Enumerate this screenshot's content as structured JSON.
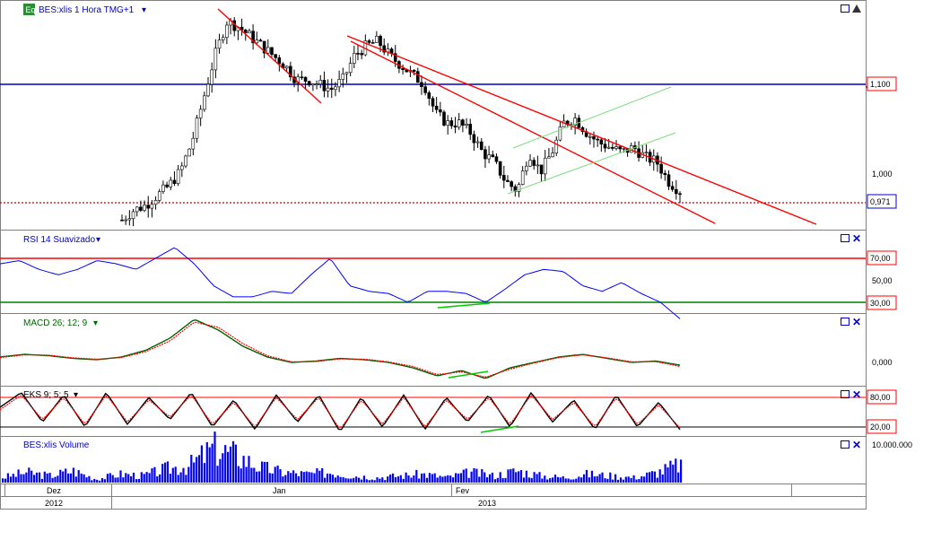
{
  "colors": {
    "frame": "#808080",
    "candle_up": "#000000",
    "candle_down": "#000000",
    "rsi": "#0000ff",
    "macd": "#006400",
    "signal": "#ff0000",
    "stoch_k": "#000000",
    "stoch_d": "#ff0000",
    "volume": "#0000ff",
    "trend": "#ff0000",
    "channel": "#7fdc7f",
    "divergence": "#00cc00",
    "level_blue": "#0000cc",
    "level_red": "#ff0000",
    "level_green": "#008000"
  },
  "header": {
    "badge": "Eq",
    "symbol_title": "BES:xlis 1 Hora TMG+1",
    "caret": "▾"
  },
  "price_panel": {
    "resistance_tag": "1,100",
    "tick_1000": "1,000",
    "last_price_tag": "0,971"
  },
  "rsi_panel": {
    "title": "RSI 14 Suavizado",
    "tags": [
      "70,00",
      "50,00",
      "30,00"
    ]
  },
  "macd_panel": {
    "title": "MACD 26; 12; 9",
    "tick": "0,000"
  },
  "stoch_panel": {
    "title": "EKS 9; 5; 5",
    "tags": [
      "80,00",
      "20,00"
    ]
  },
  "volume_panel": {
    "title": "BES:xlis Volume",
    "tick": "10.000.000"
  },
  "time_axis": {
    "months": [
      "Dez",
      "Jan",
      "Fev"
    ],
    "years": [
      "2012",
      "2013"
    ]
  },
  "chart_data": [
    {
      "type": "candlestick",
      "title": "BES:xlis 1 Hora TMG+1",
      "ylabel": "",
      "xlabel": "",
      "ylim": [
        0.94,
        1.17
      ],
      "x_months": [
        "Dez",
        "Jan",
        "Fev"
      ],
      "y_ticks": [
        1.0,
        1.1
      ],
      "horizontal_levels": [
        1.1,
        0.971
      ],
      "last_price": 0.971,
      "close_approx": [
        0.95,
        0.96,
        0.965,
        0.975,
        0.985,
        1.0,
        1.03,
        1.075,
        1.12,
        1.155,
        1.15,
        1.14,
        1.13,
        1.12,
        1.11,
        1.095,
        1.095,
        1.09,
        1.085,
        1.095,
        1.12,
        1.13,
        1.135,
        1.12,
        1.11,
        1.1,
        1.09,
        1.06,
        1.05,
        1.05,
        1.04,
        1.02,
        1.01,
        0.99,
        0.98,
        1.02,
        1.0,
        1.02,
        1.05,
        1.055,
        1.04,
        1.03,
        1.025,
        1.02,
        1.025,
        1.015,
        1.01,
        0.99,
        0.98
      ],
      "trendlines": 3,
      "channel_lines": 2
    },
    {
      "type": "line",
      "title": "RSI 14 Suavizado",
      "ylim": [
        0,
        100
      ],
      "levels": [
        70,
        50,
        30
      ],
      "series": [
        {
          "values": [
            65,
            68,
            60,
            55,
            60,
            68,
            65,
            60,
            70,
            80,
            65,
            45,
            35,
            35,
            40,
            38,
            55,
            70,
            45,
            40,
            38,
            30,
            40,
            40,
            38,
            30,
            42,
            55,
            60,
            58,
            45,
            40,
            48,
            38,
            30,
            15
          ]
        }
      ]
    },
    {
      "type": "line",
      "title": "MACD 26; 12; 9",
      "y_ticks": [
        0
      ],
      "series": [
        {
          "values": [
            0.2,
            0.3,
            0.25,
            0.15,
            0.1,
            0.2,
            0.45,
            0.9,
            1.6,
            1.2,
            0.6,
            0.2,
            0.0,
            0.05,
            0.15,
            0.1,
            0.0,
            -0.2,
            -0.5,
            -0.3,
            -0.6,
            -0.2,
            0.0,
            0.2,
            0.3,
            0.15,
            0.0,
            0.05,
            -0.1
          ]
        },
        {
          "values": [
            0.18,
            0.28,
            0.27,
            0.17,
            0.12,
            0.18,
            0.4,
            0.8,
            1.5,
            1.3,
            0.7,
            0.25,
            0.02,
            0.03,
            0.13,
            0.12,
            0.02,
            -0.15,
            -0.45,
            -0.35,
            -0.55,
            -0.25,
            -0.02,
            0.18,
            0.28,
            0.17,
            0.02,
            0.03,
            -0.15
          ]
        }
      ]
    },
    {
      "type": "line",
      "title": "EKS 9; 5; 5",
      "ylim": [
        0,
        100
      ],
      "levels": [
        80,
        20
      ],
      "series": [
        {
          "values": [
            60,
            90,
            30,
            85,
            20,
            90,
            25,
            80,
            35,
            90,
            20,
            75,
            15,
            85,
            30,
            85,
            10,
            80,
            20,
            85,
            15,
            80,
            30,
            85,
            20,
            90,
            30,
            75,
            15,
            85,
            20,
            70,
            15
          ]
        },
        {
          "values": [
            55,
            85,
            35,
            80,
            25,
            85,
            30,
            75,
            40,
            85,
            25,
            70,
            20,
            80,
            35,
            80,
            15,
            75,
            25,
            80,
            20,
            75,
            35,
            80,
            25,
            85,
            35,
            70,
            20,
            80,
            25,
            65,
            18
          ]
        }
      ]
    },
    {
      "type": "bar",
      "title": "BES:xlis Volume",
      "y_ticks": [
        10000000
      ],
      "values_relative": [
        0.15,
        0.3,
        0.2,
        0.35,
        0.1,
        0.25,
        0.2,
        0.4,
        0.5,
        1.0,
        0.8,
        0.45,
        0.3,
        0.25,
        0.3,
        0.2,
        0.15,
        0.2,
        0.25,
        0.15,
        0.3,
        0.2,
        0.35,
        0.2,
        0.15,
        0.25,
        0.2,
        0.15,
        0.3,
        0.55
      ]
    }
  ]
}
